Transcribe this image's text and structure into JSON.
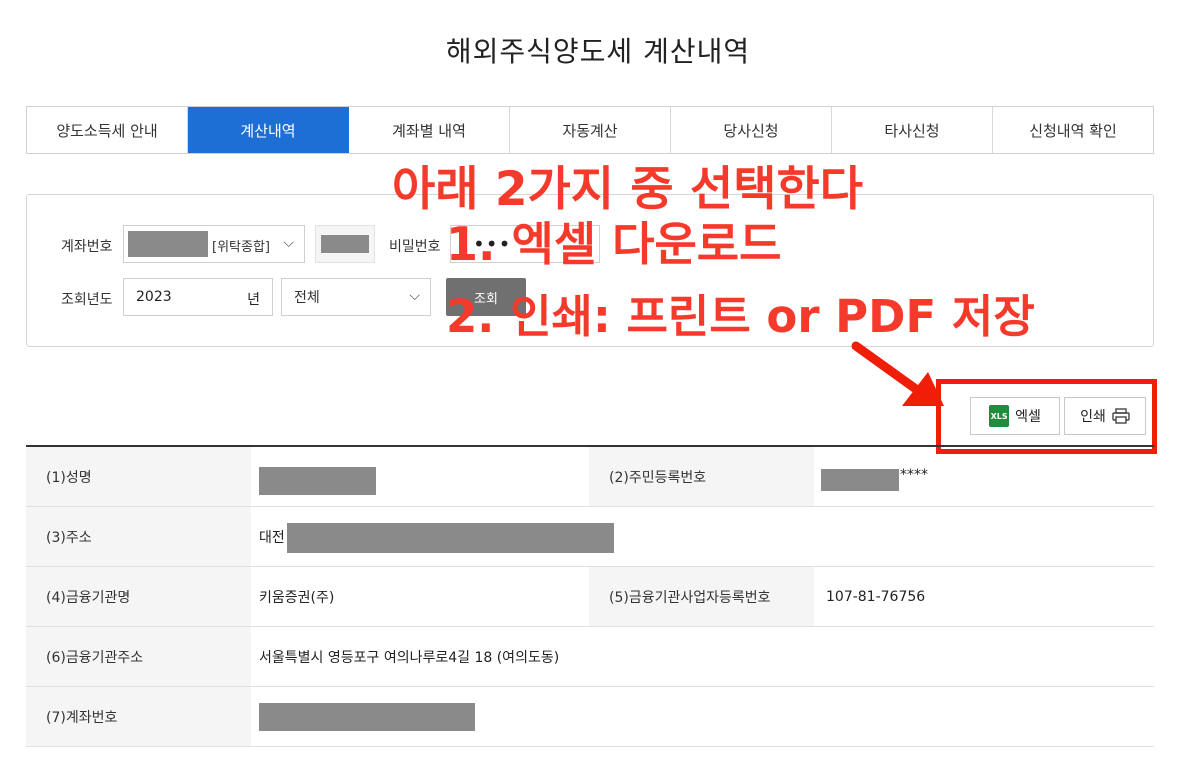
{
  "page_title": "해외주식양도세 계산내역",
  "tabs": [
    {
      "label": "양도소득세 안내",
      "active": false
    },
    {
      "label": "계산내역",
      "active": true
    },
    {
      "label": "계좌별 내역",
      "active": false
    },
    {
      "label": "자동계산",
      "active": false
    },
    {
      "label": "당사신청",
      "active": false
    },
    {
      "label": "타사신청",
      "active": false
    },
    {
      "label": "신청내역 확인",
      "active": false
    }
  ],
  "search": {
    "account_label": "계좌번호",
    "account_type": "[위탁종합]",
    "password_label": "비밀번호",
    "password_value": "•••",
    "year_label": "조회년도",
    "year_value": "2023",
    "year_unit": "년",
    "scope_value": "전체",
    "search_button": "조회"
  },
  "annotation": {
    "line1": "아래 2가지 중 선택한다",
    "line2": "1. 엑셀 다운로드",
    "line3": "2. 인쇄: 프린트 or PDF 저장"
  },
  "toolbar": {
    "excel_icon_text": "XLS",
    "excel_label": "엑셀",
    "print_label": "인쇄"
  },
  "info_table": {
    "name_label": "(1)성명",
    "rrn_label": "(2)주민등록번호",
    "rrn_suffix": "****",
    "address_label": "(3)주소",
    "address_prefix": "대전",
    "institution_label": "(4)금융기관명",
    "institution_value": "키움증권(주)",
    "biz_no_label": "(5)금융기관사업자등록번호",
    "biz_no_value": "107-81-76756",
    "institution_address_label": "(6)금융기관주소",
    "institution_address_value": "서울특별시 영등포구 여의나루로4길 18 (여의도동)",
    "account_no_label": "(7)계좌번호"
  },
  "colors": {
    "tab_active": "#1d6fd6",
    "annotation": "#f53a2c",
    "highlight_box": "#f01d08",
    "search_button": "#707070",
    "redaction": "#8a8a8a"
  }
}
